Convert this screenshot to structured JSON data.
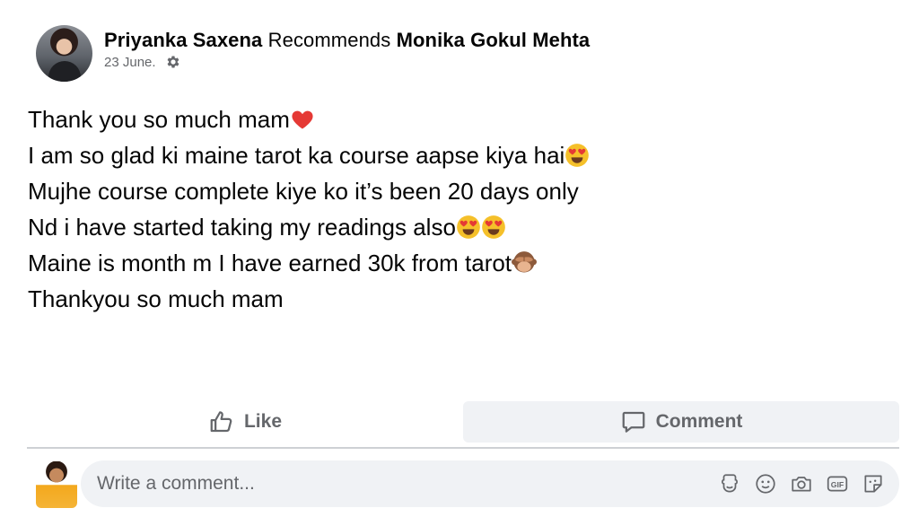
{
  "post": {
    "author": "Priyanka Saxena",
    "verb": "Recommends",
    "target": "Monika Gokul Mehta",
    "date": "23 June.",
    "lines": [
      {
        "text": "Thank you so much mam",
        "emoji": [
          "heart-emoji"
        ]
      },
      {
        "text": "I am so glad ki maine tarot ka course aapse kiya hai",
        "emoji": [
          "heart-eyes-emoji"
        ]
      },
      {
        "text": "Mujhe course complete kiye ko it’s been 20 days only",
        "emoji": []
      },
      {
        "text": "Nd i have started taking my readings also",
        "emoji": [
          "heart-eyes-emoji",
          "heart-eyes-emoji"
        ]
      },
      {
        "text": "Maine is month m I have earned 30k from tarot",
        "emoji": [
          "see-no-evil-monkey-emoji"
        ]
      },
      {
        "text": "Thankyou so much mam",
        "emoji": []
      }
    ]
  },
  "actions": {
    "like_label": "Like",
    "comment_label": "Comment"
  },
  "comment_box": {
    "placeholder": "Write a comment..."
  },
  "icons": {
    "privacy": "gear-icon",
    "like": "thumbs-up-icon",
    "comment": "speech-bubble-icon",
    "tools": [
      "avatar-sticker-icon",
      "smiley-icon",
      "camera-icon",
      "gif-icon",
      "sticker-icon"
    ]
  },
  "colors": {
    "secondary_text": "#65676b",
    "active_bg": "#f0f2f5",
    "heart": "#e53935",
    "emoji_face": "#f5c02a"
  }
}
